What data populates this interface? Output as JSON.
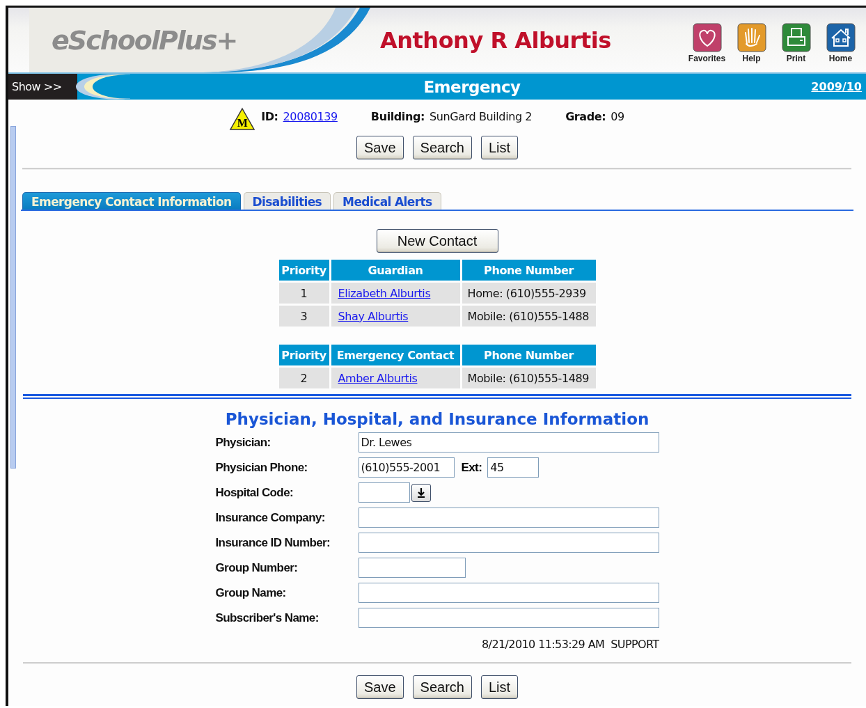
{
  "header": {
    "logo": "eSchoolPlus+",
    "student_name": "Anthony R Alburtis",
    "toolbar": [
      {
        "label": "Favorites",
        "kind": "favorites"
      },
      {
        "label": "Help",
        "kind": "help"
      },
      {
        "label": "Print",
        "kind": "print"
      },
      {
        "label": "Home",
        "kind": "home"
      }
    ]
  },
  "title_bar": {
    "show": "Show >>",
    "title": "Emergency",
    "year": "2009/10"
  },
  "student_info": {
    "alert_badge": "M",
    "id_label": "ID:",
    "id": "20080139",
    "building_label": "Building:",
    "building": "SunGard Building 2",
    "grade_label": "Grade:",
    "grade": "09"
  },
  "top_buttons": [
    "Save",
    "Search",
    "List"
  ],
  "tabs": [
    {
      "label": "Emergency Contact Information",
      "selected": true
    },
    {
      "label": "Disabilities",
      "selected": false
    },
    {
      "label": "Medical Alerts",
      "selected": false
    }
  ],
  "new_contact_button": "New Contact",
  "guardians": {
    "columns": [
      "Priority",
      "Guardian",
      "Phone Number"
    ],
    "rows": [
      [
        "1",
        "Elizabeth Alburtis",
        "Home: (610)555-2939"
      ],
      [
        "3",
        "Shay Alburtis",
        "Mobile: (610)555-1488"
      ]
    ]
  },
  "emergency_contacts": {
    "columns": [
      "Priority",
      "Emergency Contact",
      "Phone Number"
    ],
    "rows": [
      [
        "2",
        "Amber Alburtis",
        "Mobile: (610)555-1489"
      ]
    ]
  },
  "medical": {
    "title": "Physician, Hospital, and Insurance Information",
    "fields": [
      {
        "label": "Physician:",
        "kind": "wide",
        "value": "Dr. Lewes"
      },
      {
        "label": "Physician Phone:",
        "kind": "phone",
        "value": "(610)555-2001",
        "ext_label": "Ext:",
        "ext_value": "45"
      },
      {
        "label": "Hospital Code:",
        "kind": "lookup"
      },
      {
        "label": "Insurance Company:",
        "kind": "wide"
      },
      {
        "label": "Insurance ID Number:",
        "kind": "wide"
      },
      {
        "label": "Group Number:",
        "kind": "short"
      },
      {
        "label": "Group Name:",
        "kind": "wide"
      },
      {
        "label": "Subscriber's Name:",
        "kind": "wide"
      }
    ],
    "audit": "8/21/2010 11:53:29 AM  SUPPORT"
  },
  "bottom_buttons": [
    "Save",
    "Search",
    "List"
  ]
}
